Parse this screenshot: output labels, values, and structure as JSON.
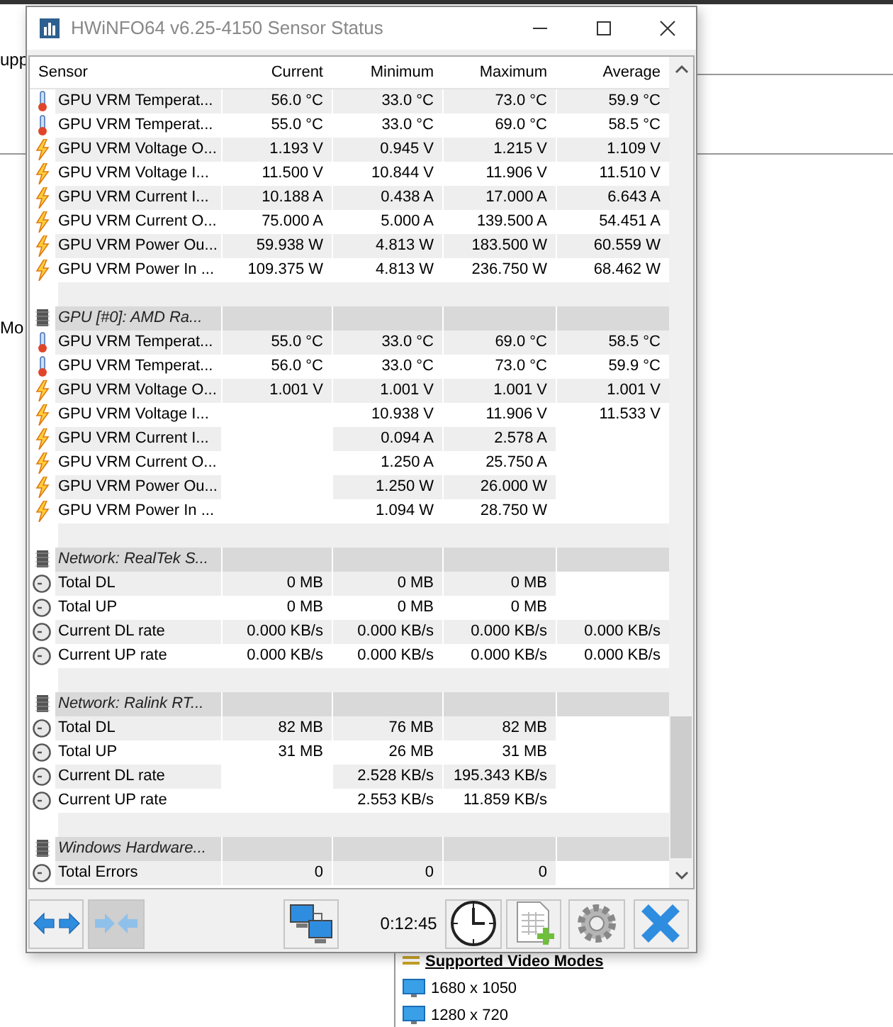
{
  "background": {
    "left_labels": [
      "upp",
      "Mo"
    ],
    "video_modes": {
      "title": "Supported Video Modes",
      "modes": [
        "1680 x 1050",
        "1280 x 720"
      ]
    }
  },
  "window": {
    "title": "HWiNFO64 v6.25-4150 Sensor Status"
  },
  "table": {
    "columns": [
      "Sensor",
      "Current",
      "Minimum",
      "Maximum",
      "Average"
    ],
    "sections": [
      {
        "rows": [
          {
            "kind": "temperature",
            "name": "GPU VRM Temperat...",
            "current": "56.0 °C",
            "minimum": "33.0 °C",
            "maximum": "73.0 °C",
            "average": "59.9 °C"
          },
          {
            "kind": "temperature",
            "name": "GPU VRM Temperat...",
            "current": "55.0 °C",
            "minimum": "33.0 °C",
            "maximum": "69.0 °C",
            "average": "58.5 °C"
          },
          {
            "kind": "electric",
            "name": "GPU VRM Voltage O...",
            "current": "1.193 V",
            "minimum": "0.945 V",
            "maximum": "1.215 V",
            "average": "1.109 V"
          },
          {
            "kind": "electric",
            "name": "GPU VRM Voltage I...",
            "current": "11.500 V",
            "minimum": "10.844 V",
            "maximum": "11.906 V",
            "average": "11.510 V"
          },
          {
            "kind": "electric",
            "name": "GPU VRM Current I...",
            "current": "10.188 A",
            "minimum": "0.438 A",
            "maximum": "17.000 A",
            "average": "6.643 A"
          },
          {
            "kind": "electric",
            "name": "GPU VRM Current O...",
            "current": "75.000 A",
            "minimum": "5.000 A",
            "maximum": "139.500 A",
            "average": "54.451 A"
          },
          {
            "kind": "electric",
            "name": "GPU VRM Power Ou...",
            "current": "59.938 W",
            "minimum": "4.813 W",
            "maximum": "183.500 W",
            "average": "60.559 W"
          },
          {
            "kind": "electric",
            "name": "GPU VRM Power In ...",
            "current": "109.375 W",
            "minimum": "4.813 W",
            "maximum": "236.750 W",
            "average": "68.462 W"
          }
        ]
      },
      {
        "title": "GPU [#0]: AMD Ra...",
        "rows": [
          {
            "kind": "temperature",
            "name": "GPU VRM Temperat...",
            "current": "55.0 °C",
            "minimum": "33.0 °C",
            "maximum": "69.0 °C",
            "average": "58.5 °C"
          },
          {
            "kind": "temperature",
            "name": "GPU VRM Temperat...",
            "current": "56.0 °C",
            "minimum": "33.0 °C",
            "maximum": "73.0 °C",
            "average": "59.9 °C"
          },
          {
            "kind": "electric",
            "name": "GPU VRM Voltage O...",
            "current": "1.001 V",
            "minimum": "1.001 V",
            "maximum": "1.001 V",
            "average": "1.001 V"
          },
          {
            "kind": "electric",
            "name": "GPU VRM Voltage I...",
            "minimum": "10.938 V",
            "maximum": "11.906 V",
            "average": "11.533 V"
          },
          {
            "kind": "electric",
            "name": "GPU VRM Current I...",
            "minimum": "0.094 A",
            "maximum": "2.578 A"
          },
          {
            "kind": "electric",
            "name": "GPU VRM Current O...",
            "minimum": "1.250 A",
            "maximum": "25.750 A"
          },
          {
            "kind": "electric",
            "name": "GPU VRM Power Ou...",
            "minimum": "1.250 W",
            "maximum": "26.000 W"
          },
          {
            "kind": "electric",
            "name": "GPU VRM Power In ...",
            "minimum": "1.094 W",
            "maximum": "28.750 W"
          }
        ]
      },
      {
        "title": "Network: RealTek S...",
        "rows": [
          {
            "kind": "counter",
            "name": "Total DL",
            "current": "0 MB",
            "minimum": "0 MB",
            "maximum": "0 MB"
          },
          {
            "kind": "counter",
            "name": "Total UP",
            "current": "0 MB",
            "minimum": "0 MB",
            "maximum": "0 MB"
          },
          {
            "kind": "counter",
            "name": "Current DL rate",
            "current": "0.000 KB/s",
            "minimum": "0.000 KB/s",
            "maximum": "0.000 KB/s",
            "average": "0.000 KB/s"
          },
          {
            "kind": "counter",
            "name": "Current UP rate",
            "current": "0.000 KB/s",
            "minimum": "0.000 KB/s",
            "maximum": "0.000 KB/s",
            "average": "0.000 KB/s"
          }
        ]
      },
      {
        "title": "Network: Ralink RT...",
        "rows": [
          {
            "kind": "counter",
            "name": "Total DL",
            "current": "82 MB",
            "minimum": "76 MB",
            "maximum": "82 MB"
          },
          {
            "kind": "counter",
            "name": "Total UP",
            "current": "31 MB",
            "minimum": "26 MB",
            "maximum": "31 MB"
          },
          {
            "kind": "counter",
            "name": "Current DL rate",
            "minimum": "2.528 KB/s",
            "maximum": "195.343 KB/s"
          },
          {
            "kind": "counter",
            "name": "Current UP rate",
            "minimum": "2.553 KB/s",
            "maximum": "11.859 KB/s"
          }
        ]
      },
      {
        "title": "Windows Hardware...",
        "rows": [
          {
            "kind": "counter",
            "name": "Total Errors",
            "current": "0",
            "minimum": "0",
            "maximum": "0"
          }
        ]
      }
    ]
  },
  "toolbar": {
    "items": [
      {
        "kind": "expand",
        "pressed": false
      },
      {
        "kind": "collapse",
        "pressed": true
      },
      {
        "kind": "network",
        "pressed": false
      },
      {
        "kind": "timer",
        "text": "0:12:45"
      },
      {
        "kind": "clock",
        "pressed": false
      },
      {
        "kind": "report",
        "pressed": false
      },
      {
        "kind": "settings",
        "pressed": false
      },
      {
        "kind": "close",
        "pressed": false
      }
    ]
  }
}
